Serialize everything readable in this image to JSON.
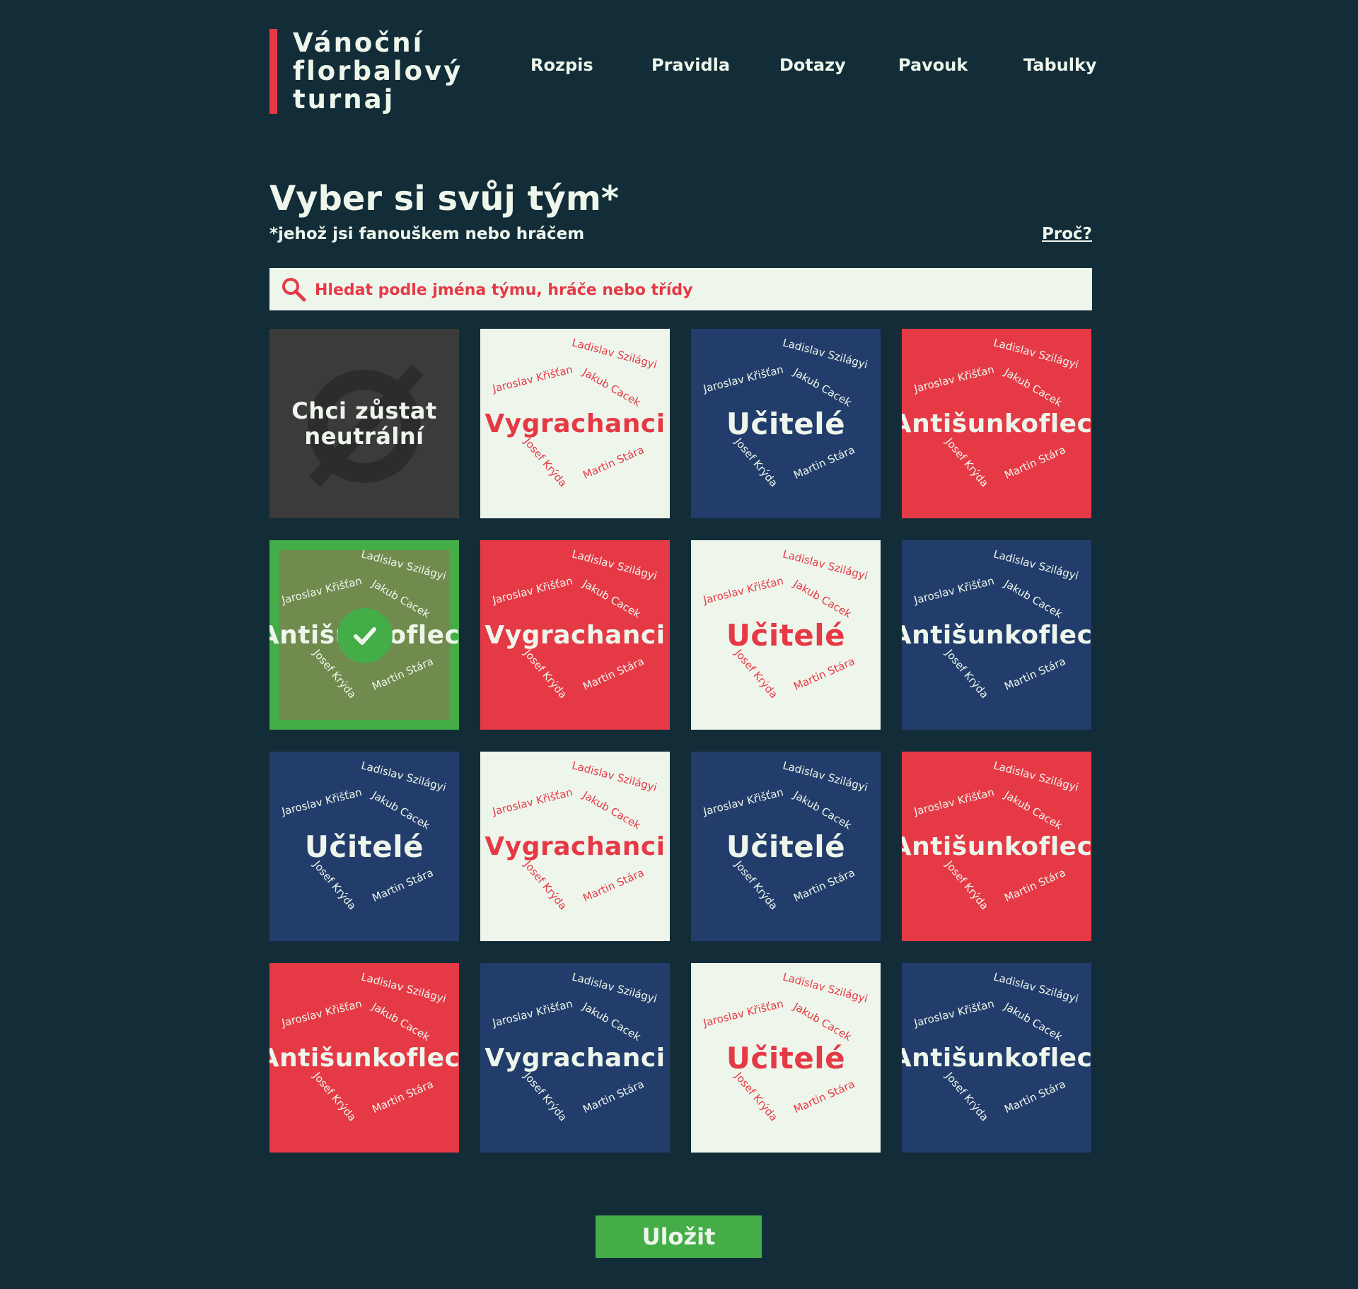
{
  "logo": {
    "line1": "Vánoční",
    "line2": "florbalový",
    "line3": "turnaj"
  },
  "nav": {
    "items": [
      "Rozpis",
      "Pravidla",
      "Dotazy",
      "Pavouk",
      "Tabulky"
    ]
  },
  "heading": {
    "title": "Vyber si svůj tým*",
    "subtitle": "*jehož jsi fanouškem nebo hráčem",
    "why_link": "Proč?"
  },
  "search": {
    "placeholder": "Hledat podle jména týmu, hráče nebo třídy",
    "icon": "search-icon"
  },
  "players": [
    "Ladislav Szilágyi",
    "Jaroslav Křišťan",
    "Jakub Cacek",
    "Josef Krýda",
    "Martin Stára"
  ],
  "neutral_card": {
    "label": "Chci zůstat neutrální",
    "icon": "empty-set-icon"
  },
  "teams": [
    {
      "name": "Vygrachanci",
      "color": "white"
    },
    {
      "name": "Učitelé",
      "color": "navy"
    },
    {
      "name": "Antišunkofleci",
      "color": "red"
    },
    {
      "name": "Antišunkofleci",
      "color": "selected",
      "selected": true
    },
    {
      "name": "Vygrachanci",
      "color": "red"
    },
    {
      "name": "Učitelé",
      "color": "white"
    },
    {
      "name": "Antišunkofleci",
      "color": "navy"
    },
    {
      "name": "Učitelé",
      "color": "navy"
    },
    {
      "name": "Vygrachanci",
      "color": "white"
    },
    {
      "name": "Učitelé",
      "color": "navy"
    },
    {
      "name": "Antišunkofleci",
      "color": "red"
    },
    {
      "name": "Antišunkofleci",
      "color": "red"
    },
    {
      "name": "Vygrachanci",
      "color": "navy"
    },
    {
      "name": "Učitelé",
      "color": "white"
    },
    {
      "name": "Antišunkofleci",
      "color": "navy"
    }
  ],
  "colors": {
    "background": "#122d38",
    "red": "#e63946",
    "white": "#eef6ec",
    "navy": "#223d6b",
    "green": "#44ad48",
    "neutral": "#3b3b3b"
  },
  "save_button": {
    "label": "Uložit"
  }
}
